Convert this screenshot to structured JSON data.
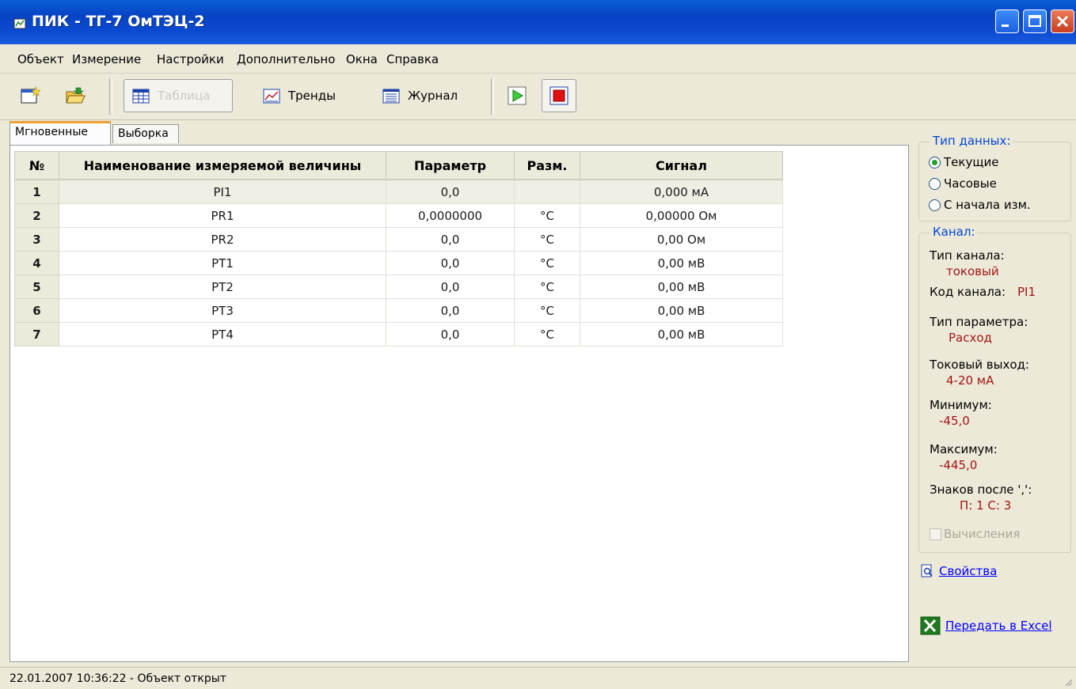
{
  "window": {
    "title": "ПИК - ТГ-7 ОмТЭЦ-2"
  },
  "menu": [
    "Объект",
    "Измерение",
    "Настройки",
    "Дополнительно",
    "Окна",
    "Справка"
  ],
  "toolbar": {
    "table_label": "Таблица",
    "trends_label": "Тренды",
    "journal_label": "Журнал"
  },
  "tabs": [
    "Мгновенные",
    "Выборка"
  ],
  "table": {
    "headers": [
      "№",
      "Наименование измеряемой величины",
      "Параметр",
      "Разм.",
      "Сигнал"
    ],
    "rows": [
      {
        "num": "1",
        "name": "PI1",
        "param": "0,0",
        "unit": "",
        "signal": "0,000 мА"
      },
      {
        "num": "2",
        "name": "PR1",
        "param": "0,0000000",
        "unit": "°C",
        "signal": "0,00000 Ом"
      },
      {
        "num": "3",
        "name": "PR2",
        "param": "0,0",
        "unit": "°C",
        "signal": "0,00 Ом"
      },
      {
        "num": "4",
        "name": "PT1",
        "param": "0,0",
        "unit": "°C",
        "signal": "0,00 мВ"
      },
      {
        "num": "5",
        "name": "PT2",
        "param": "0,0",
        "unit": "°C",
        "signal": "0,00 мВ"
      },
      {
        "num": "6",
        "name": "PT3",
        "param": "0,0",
        "unit": "°C",
        "signal": "0,00 мВ"
      },
      {
        "num": "7",
        "name": "PT4",
        "param": "0,0",
        "unit": "°C",
        "signal": "0,00 мВ"
      }
    ]
  },
  "data_type": {
    "title": "Тип данных:",
    "options": [
      "Текущие",
      "Часовые",
      "С начала изм."
    ],
    "selected_index": 0
  },
  "channel": {
    "title": "Канал:",
    "type_label": "Тип канала:",
    "type_value": "токовый",
    "code_label": "Код канала:",
    "code_value": "PI1",
    "param_type_label": "Тип параметра:",
    "param_type_value": "Расход",
    "current_out_label": "Токовый выход:",
    "current_out_value": "4-20 мА",
    "min_label": "Минимум:",
    "min_value": "-45,0",
    "max_label": "Максимум:",
    "max_value": "-445,0",
    "decimals_label": "Знаков после ',':",
    "decimals_value": "П: 1  С: 3",
    "calc_label": "Вычисления",
    "calc_checked": false
  },
  "links": {
    "properties": "Свойства",
    "excel": "Передать в Excel"
  },
  "status": {
    "text": "22.01.2007 10:36:22 - Объект открыт"
  },
  "colors": {
    "title_bar": "#0843c4",
    "accent_value": "#a31515",
    "link": "#0000ff"
  }
}
